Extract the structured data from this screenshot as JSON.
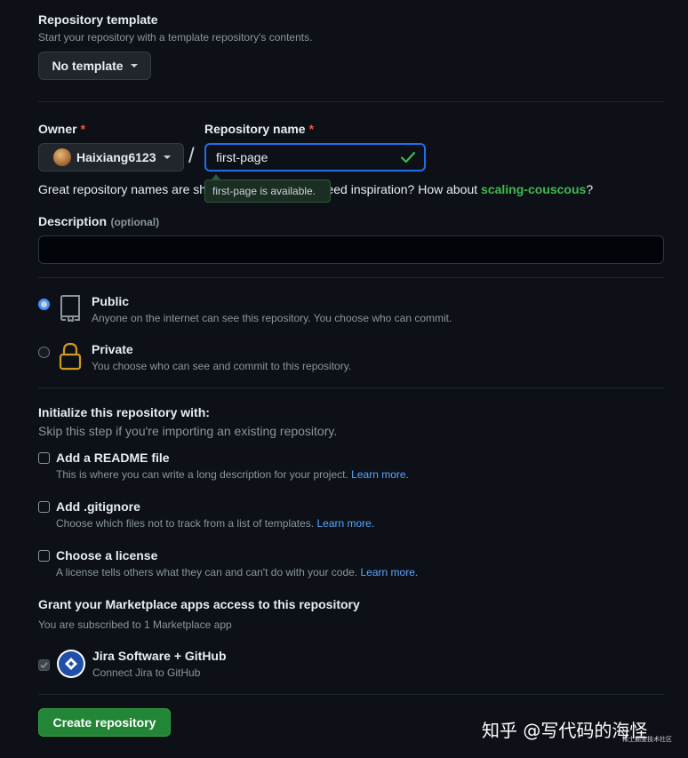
{
  "template": {
    "label": "Repository template",
    "hint": "Start your repository with a template repository's contents.",
    "button_label": "No template"
  },
  "owner": {
    "label": "Owner",
    "required_mark": "*",
    "name": "Haixiang6123"
  },
  "slash": "/",
  "repo_name": {
    "label": "Repository name",
    "required_mark": "*",
    "value": "first-page",
    "status_icon": "check-icon",
    "tooltip": "first-page is available."
  },
  "name_hint": {
    "before": "Great repository names are short and memorable. Need inspiration? How about ",
    "suggestion": "scaling-couscous",
    "after": "?"
  },
  "description": {
    "label": "Description",
    "optional": "(optional)",
    "value": ""
  },
  "visibility": {
    "options": [
      {
        "title": "Public",
        "desc": "Anyone on the internet can see this repository. You choose who can commit.",
        "checked": true,
        "icon": "repo-icon"
      },
      {
        "title": "Private",
        "desc": "You choose who can see and commit to this repository.",
        "checked": false,
        "icon": "lock-icon"
      }
    ]
  },
  "init": {
    "title": "Initialize this repository with:",
    "hint": "Skip this step if you're importing an existing repository.",
    "options": [
      {
        "title": "Add a README file",
        "desc": "This is where you can write a long description for your project.",
        "link": "Learn more."
      },
      {
        "title": "Add .gitignore",
        "desc": "Choose which files not to track from a list of templates.",
        "link": "Learn more."
      },
      {
        "title": "Choose a license",
        "desc": "A license tells others what they can and can't do with your code.",
        "link": "Learn more."
      }
    ]
  },
  "marketplace": {
    "title": "Grant your Marketplace apps access to this repository",
    "hint": "You are subscribed to 1 Marketplace app",
    "app_name": "Jira Software + GitHub",
    "app_desc": "Connect Jira to GitHub"
  },
  "create_button": "Create repository",
  "watermark": {
    "main": "知乎 @写代码的海怪",
    "small": "稀土掘金技术社区"
  },
  "colors": {
    "background": "#0d1117",
    "primary_button": "#238636",
    "link": "#58a6ff",
    "success": "#3fb950",
    "required": "#f85149"
  }
}
